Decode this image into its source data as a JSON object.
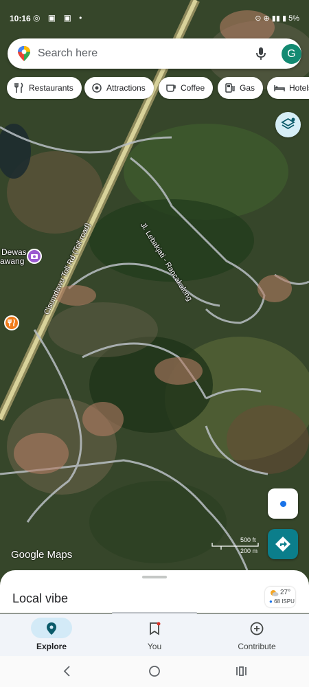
{
  "status_bar": {
    "time": "10:16",
    "right_text": "5%"
  },
  "search": {
    "placeholder": "Search here",
    "avatar_letter": "G"
  },
  "chips": [
    {
      "label": "Restaurants",
      "icon": "fork-knife-icon"
    },
    {
      "label": "Attractions",
      "icon": "camera-icon"
    },
    {
      "label": "Coffee",
      "icon": "coffee-cup-icon"
    },
    {
      "label": "Gas",
      "icon": "gas-pump-icon"
    },
    {
      "label": "Hotels",
      "icon": "bed-icon"
    }
  ],
  "map": {
    "labels": {
      "road_lebak": "Jl. Lebakjati - Rancakalong",
      "road_toll": "Cisumdawu Toll Rd (Toll road)",
      "place_dewas": "Dewas",
      "place_awang": "awang"
    },
    "logo": "Google Maps",
    "scale": {
      "imperial": "500 ft",
      "metric": "200 m"
    }
  },
  "sheet": {
    "title": "Local vibe",
    "weather": {
      "temp": "27°",
      "aqi": "68 ISPU"
    }
  },
  "nav": [
    {
      "label": "Explore",
      "active": true,
      "icon": "explore-pin-icon"
    },
    {
      "label": "You",
      "active": false,
      "icon": "bookmark-icon"
    },
    {
      "label": "Contribute",
      "active": false,
      "icon": "add-circle-icon"
    }
  ],
  "colors": {
    "accent": "#0b7e8b",
    "avatar": "#138a72",
    "active_pill": "#d3eaf7"
  }
}
